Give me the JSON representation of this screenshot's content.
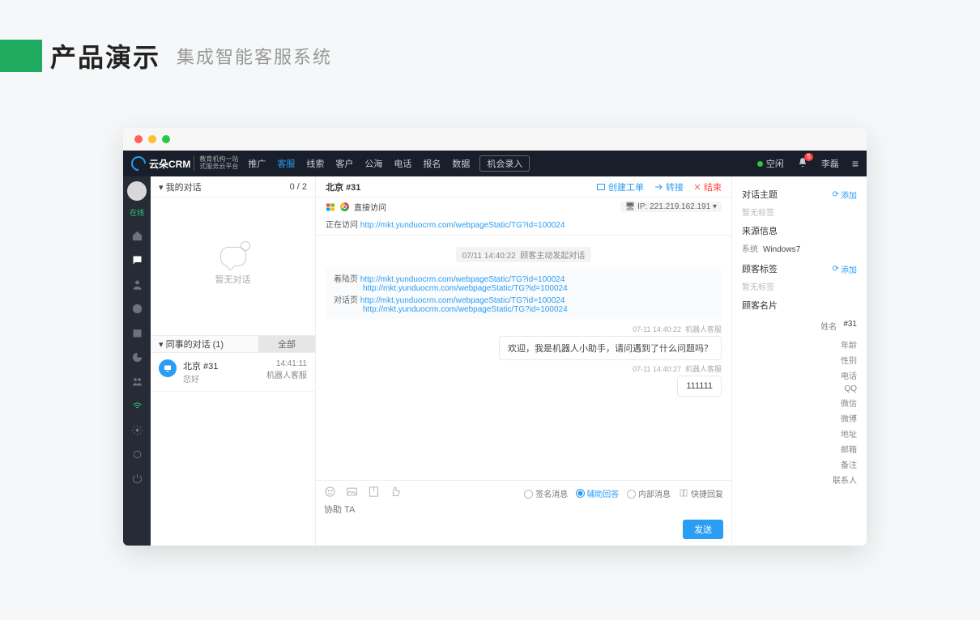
{
  "slide": {
    "title": "产品演示",
    "subtitle": "集成智能客服系统"
  },
  "nav": {
    "brand": "云朵CRM",
    "tagline1": "教育机构一站",
    "tagline2": "式服务云平台",
    "items": [
      "推广",
      "客服",
      "线索",
      "客户",
      "公海",
      "电话",
      "报名",
      "数据"
    ],
    "active": "客服",
    "record": "机会录入",
    "status": "空闲",
    "user": "李磊",
    "notif": "5"
  },
  "sidebar": {
    "status": "在线"
  },
  "myConv": {
    "title": "我的对话",
    "count": "0 / 2",
    "empty": "暂无对话"
  },
  "colleague": {
    "title": "同事的对话 (1)",
    "all": "全部",
    "item": {
      "name": "北京 #31",
      "preview": "您好",
      "time": "14:41:11",
      "agent": "机器人客服"
    }
  },
  "chat": {
    "title": "北京 #31",
    "actions": {
      "ticket": "创建工单",
      "transfer": "转接",
      "end": "结束"
    },
    "visitType": "直接访问",
    "ipLabel": "IP:",
    "ip": "221.219.162.191",
    "visitingLabel": "正在访问",
    "visitingUrl": "http://mkt.yunduocrm.com/webpageStatic/TG?id=100024",
    "chipTime": "07/11 14:40:22",
    "chipText": "顾客主动发起对话",
    "landingLabel": "着陆页",
    "dialogLabel": "对话页",
    "url": "http://mkt.yunduocrm.com/webpageStatic/TG?id=100024",
    "m1time": "07-11 14:40:22",
    "m1agent": "机器人客服",
    "m1text": "欢迎，我是机器人小助手，请问遇到了什么问题吗？",
    "m2time": "07-11 14:40:27",
    "m2agent": "机器人客服",
    "m2text": "111111",
    "composer": {
      "signed": "签名消息",
      "assist": "辅助回答",
      "internal": "内部消息",
      "quick": "快捷回复",
      "placeholder": "协助 TA",
      "send": "发送"
    }
  },
  "side": {
    "topic": "对话主题",
    "add": "添加",
    "noTag": "暂无标签",
    "source": "来源信息",
    "sysLabel": "系统",
    "sysVal": "Windows7",
    "tags": "顾客标签",
    "card": "顾客名片",
    "fields": {
      "name": "姓名",
      "nameVal": "#31",
      "age": "年龄",
      "sex": "性别",
      "phone": "电话",
      "qq": "QQ",
      "wechat": "微信",
      "weibo": "微博",
      "addr": "地址",
      "email": "邮箱",
      "note": "备注",
      "contact": "联系人"
    }
  }
}
